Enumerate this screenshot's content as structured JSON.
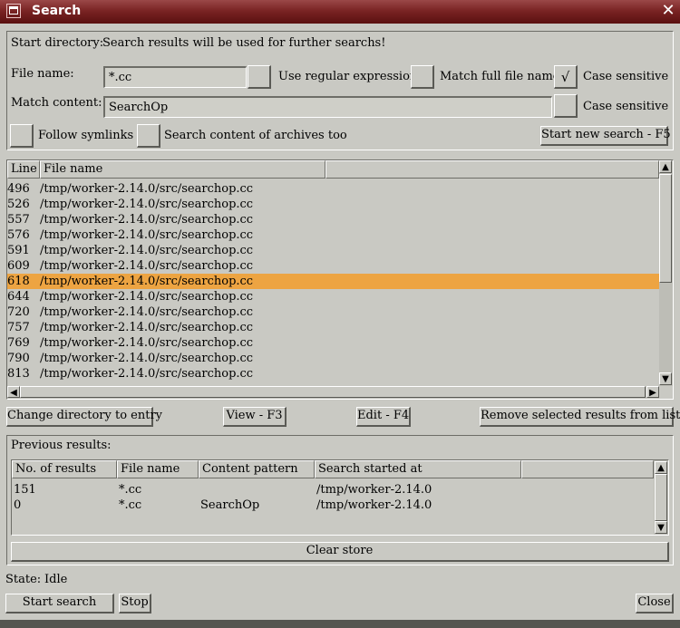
{
  "window": {
    "title": "Search",
    "menu_icon": "window-menu-icon",
    "close_glyph": "✕"
  },
  "start_directory": {
    "label": "Start directory:",
    "value": "Search results will be used for further searchs!"
  },
  "file_name": {
    "label": "File name:",
    "value": "*.cc"
  },
  "use_regex": {
    "label": "Use regular expression",
    "checked": false
  },
  "match_full": {
    "label": "Match full file name",
    "checked": true,
    "check_glyph": "√"
  },
  "case_sensitive_file": {
    "label": "Case sensitive"
  },
  "match_content": {
    "label": "Match content:",
    "value": "SearchOp"
  },
  "case_sensitive_content": {
    "label": "Case sensitive",
    "checked": false
  },
  "follow_symlinks": {
    "label": "Follow symlinks",
    "checked": false
  },
  "search_archives": {
    "label": "Search content of archives too",
    "checked": false
  },
  "start_new_search": "Start new search - F5",
  "results": {
    "headers": [
      "Line",
      "File name"
    ],
    "rows": [
      {
        "line": "496",
        "file": "/tmp/worker-2.14.0/src/searchop.cc"
      },
      {
        "line": "526",
        "file": "/tmp/worker-2.14.0/src/searchop.cc"
      },
      {
        "line": "557",
        "file": "/tmp/worker-2.14.0/src/searchop.cc"
      },
      {
        "line": "576",
        "file": "/tmp/worker-2.14.0/src/searchop.cc"
      },
      {
        "line": "591",
        "file": "/tmp/worker-2.14.0/src/searchop.cc"
      },
      {
        "line": "609",
        "file": "/tmp/worker-2.14.0/src/searchop.cc"
      },
      {
        "line": "618",
        "file": "/tmp/worker-2.14.0/src/searchop.cc"
      },
      {
        "line": "644",
        "file": "/tmp/worker-2.14.0/src/searchop.cc"
      },
      {
        "line": "720",
        "file": "/tmp/worker-2.14.0/src/searchop.cc"
      },
      {
        "line": "757",
        "file": "/tmp/worker-2.14.0/src/searchop.cc"
      },
      {
        "line": "769",
        "file": "/tmp/worker-2.14.0/src/searchop.cc"
      },
      {
        "line": "790",
        "file": "/tmp/worker-2.14.0/src/searchop.cc"
      },
      {
        "line": "813",
        "file": "/tmp/worker-2.14.0/src/searchop.cc"
      }
    ],
    "selected_index": 6,
    "highlight_color": "#eda442"
  },
  "actions": {
    "change_dir": "Change directory to entry",
    "view": "View - F3",
    "edit": "Edit - F4",
    "remove": "Remove selected results from list"
  },
  "previous": {
    "label": "Previous results:",
    "headers": [
      "No. of results",
      "File name",
      "Content pattern",
      "Search started at"
    ],
    "rows": [
      {
        "count": "151",
        "file": "*.cc",
        "pattern": "",
        "started": "/tmp/worker-2.14.0"
      },
      {
        "count": "0",
        "file": "*.cc",
        "pattern": "SearchOp",
        "started": "/tmp/worker-2.14.0"
      }
    ]
  },
  "clear_store": "Clear store",
  "state": {
    "label": "State:",
    "value": "Idle"
  },
  "footer": {
    "start_search": "Start search",
    "stop": "Stop",
    "close": "Close"
  },
  "scroll": {
    "up": "▲",
    "down": "▼",
    "left": "◀",
    "right": "▶"
  }
}
